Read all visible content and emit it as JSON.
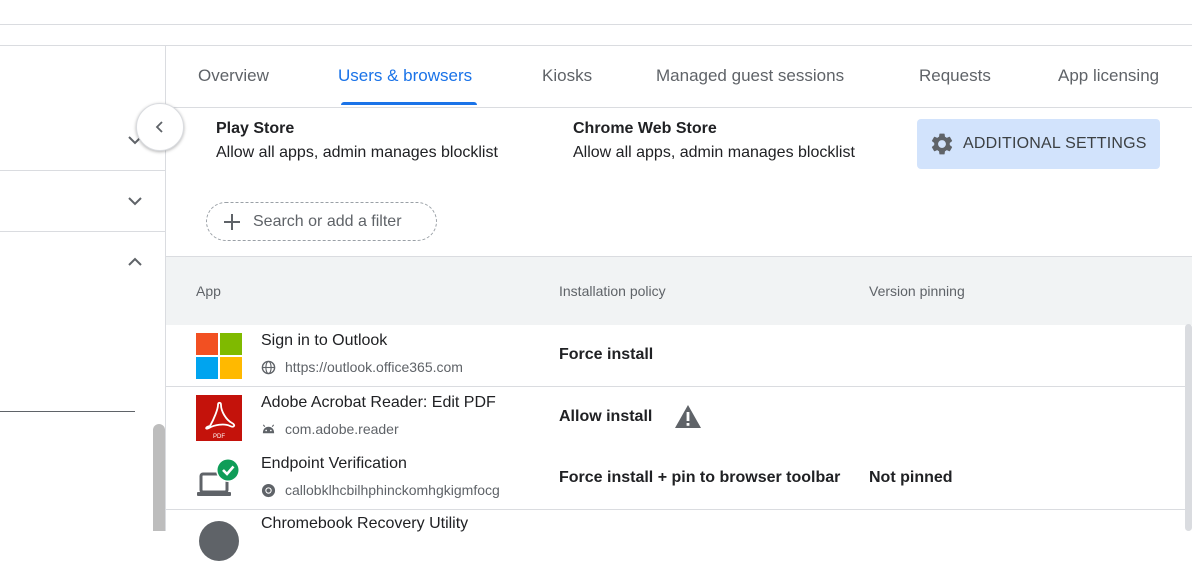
{
  "tabs": [
    {
      "label": "Overview",
      "active": false
    },
    {
      "label": "Users & browsers",
      "active": true
    },
    {
      "label": "Kiosks",
      "active": false
    },
    {
      "label": "Managed guest sessions",
      "active": false
    },
    {
      "label": "Requests",
      "active": false
    },
    {
      "label": "App licensing",
      "active": false
    }
  ],
  "stores": [
    {
      "title": "Play Store",
      "setting": "Allow all apps, admin manages blocklist"
    },
    {
      "title": "Chrome Web Store",
      "setting": "Allow all apps, admin manages blocklist"
    }
  ],
  "additional_settings_label": "ADDITIONAL SETTINGS",
  "filter_placeholder": "Search or add a filter",
  "table": {
    "columns": [
      "App",
      "Installation policy",
      "Version pinning"
    ],
    "rows": [
      {
        "name": "Sign in to Outlook",
        "sub": "https://outlook.office365.com",
        "sub_icon": "globe-icon",
        "policy": "Force install",
        "pinning": "",
        "icon": "microsoft-logo-icon"
      },
      {
        "name": "Adobe Acrobat Reader: Edit PDF",
        "sub": "com.adobe.reader",
        "sub_icon": "android-icon",
        "policy": "Allow install",
        "pinning": "",
        "icon": "adobe-acrobat-icon",
        "warning": true
      },
      {
        "name": "Endpoint Verification",
        "sub": "callobklhcbilhphinckomhgkigmfocg",
        "sub_icon": "chrome-icon",
        "policy": "Force install + pin to browser toolbar",
        "pinning": "Not pinned",
        "icon": "endpoint-verification-icon"
      },
      {
        "name": "Chromebook Recovery Utility",
        "sub": "",
        "policy": "",
        "pinning": "",
        "icon": "recovery-utility-icon"
      }
    ]
  },
  "colors": {
    "accent": "#1a73e8",
    "button_bg": "#d2e3fc",
    "header_bg": "#f1f3f4"
  }
}
